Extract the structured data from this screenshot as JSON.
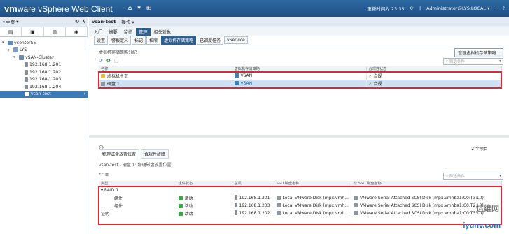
{
  "topbar": {
    "brand_vm": "vm",
    "brand_ware": "ware",
    "brand_product": " vSphere Web Client",
    "home_icon": "home-icon",
    "updated": "更新时间为 23:35",
    "user": "Administrator@LYS.LOCAL ▾",
    "help": "?"
  },
  "left": {
    "back": "主页",
    "tabs": [
      "tab-vms-hosts",
      "tab-storage",
      "tab-network",
      "tab-list"
    ],
    "tree": [
      {
        "label": "vcenter55",
        "level": 0,
        "icon": "vc"
      },
      {
        "label": "LYS",
        "level": 1,
        "icon": "dc"
      },
      {
        "label": "vSAN-Cluster",
        "level": 2,
        "icon": "cl"
      },
      {
        "label": "192.168.1.201",
        "level": 3,
        "icon": "host"
      },
      {
        "label": "192.168.1.202",
        "level": 3,
        "icon": "host"
      },
      {
        "label": "192.168.1.203",
        "level": 3,
        "icon": "host"
      },
      {
        "label": "192.168.1.204",
        "level": 3,
        "icon": "host"
      },
      {
        "label": "vsan-test",
        "level": 3,
        "icon": "vm",
        "selected": true
      }
    ]
  },
  "main": {
    "title": "vsan-test",
    "actions": "操作 ▾",
    "tabs": [
      "入门",
      "摘要",
      "监控",
      "管理",
      "相关对象"
    ],
    "active_tab": 3,
    "subtabs": [
      "设置",
      "警报定义",
      "标记",
      "权限",
      "虚拟机存储策略",
      "已调度任务",
      "vService"
    ],
    "active_subtab": 4
  },
  "policy": {
    "section_title": "虚拟机存储策略分配",
    "manage_button": "管理虚拟机存储策略...",
    "filter_placeholder": "筛选条件",
    "headers": [
      "名称",
      "虚拟机存储策略",
      "合规性状态"
    ],
    "rows": [
      {
        "name": "虚拟机主页",
        "icon": "folder",
        "policy": "VSAN",
        "status": "合规",
        "selected": false
      },
      {
        "name": "硬盘 1",
        "icon": "disk",
        "policy": "VSAN",
        "status": "合规",
        "selected": true
      }
    ]
  },
  "bottom": {
    "count": "2 个项目",
    "tabs": [
      "物理磁盘放置位置",
      "合规性故障"
    ],
    "title": "vsan-test - 硬盘 1: 物理磁盘放置位置",
    "filter_placeholder": "筛选条件",
    "headers": [
      "类型",
      "组件状态",
      "主机",
      "SSD 磁盘名称",
      "非 SSD 磁盘名称"
    ],
    "rows": [
      {
        "type": "RAID 1",
        "indent": 0,
        "state": "",
        "host": "",
        "ssd": "",
        "hdd": ""
      },
      {
        "type": "组件",
        "indent": 1,
        "state": "活动",
        "host": "192.168.1.201",
        "ssd": "Local VMware Disk (mpx.vmh...",
        "hdd": "VMware Serial Attached SCSI Disk (mpx.vmhba1:C0:T3:L0)"
      },
      {
        "type": "组件",
        "indent": 1,
        "state": "活动",
        "host": "192.168.1.203",
        "ssd": "Local VMware Disk (mpx.vmh...",
        "hdd": "VMware Serial Attached SCSI Disk (mpx.vmhba1:C0:T2:L0)"
      },
      {
        "type": "证明",
        "indent": 0,
        "state": "活动",
        "host": "192.168.1.202",
        "ssd": "Local VMware Disk (mpx.vmh...",
        "hdd": "VMware Serial Attached SCSI Disk (mpx.vmhba1:C0:T3:L0)"
      }
    ]
  },
  "watermark": {
    "cn": "运维网",
    "en": "iyunv.com"
  }
}
